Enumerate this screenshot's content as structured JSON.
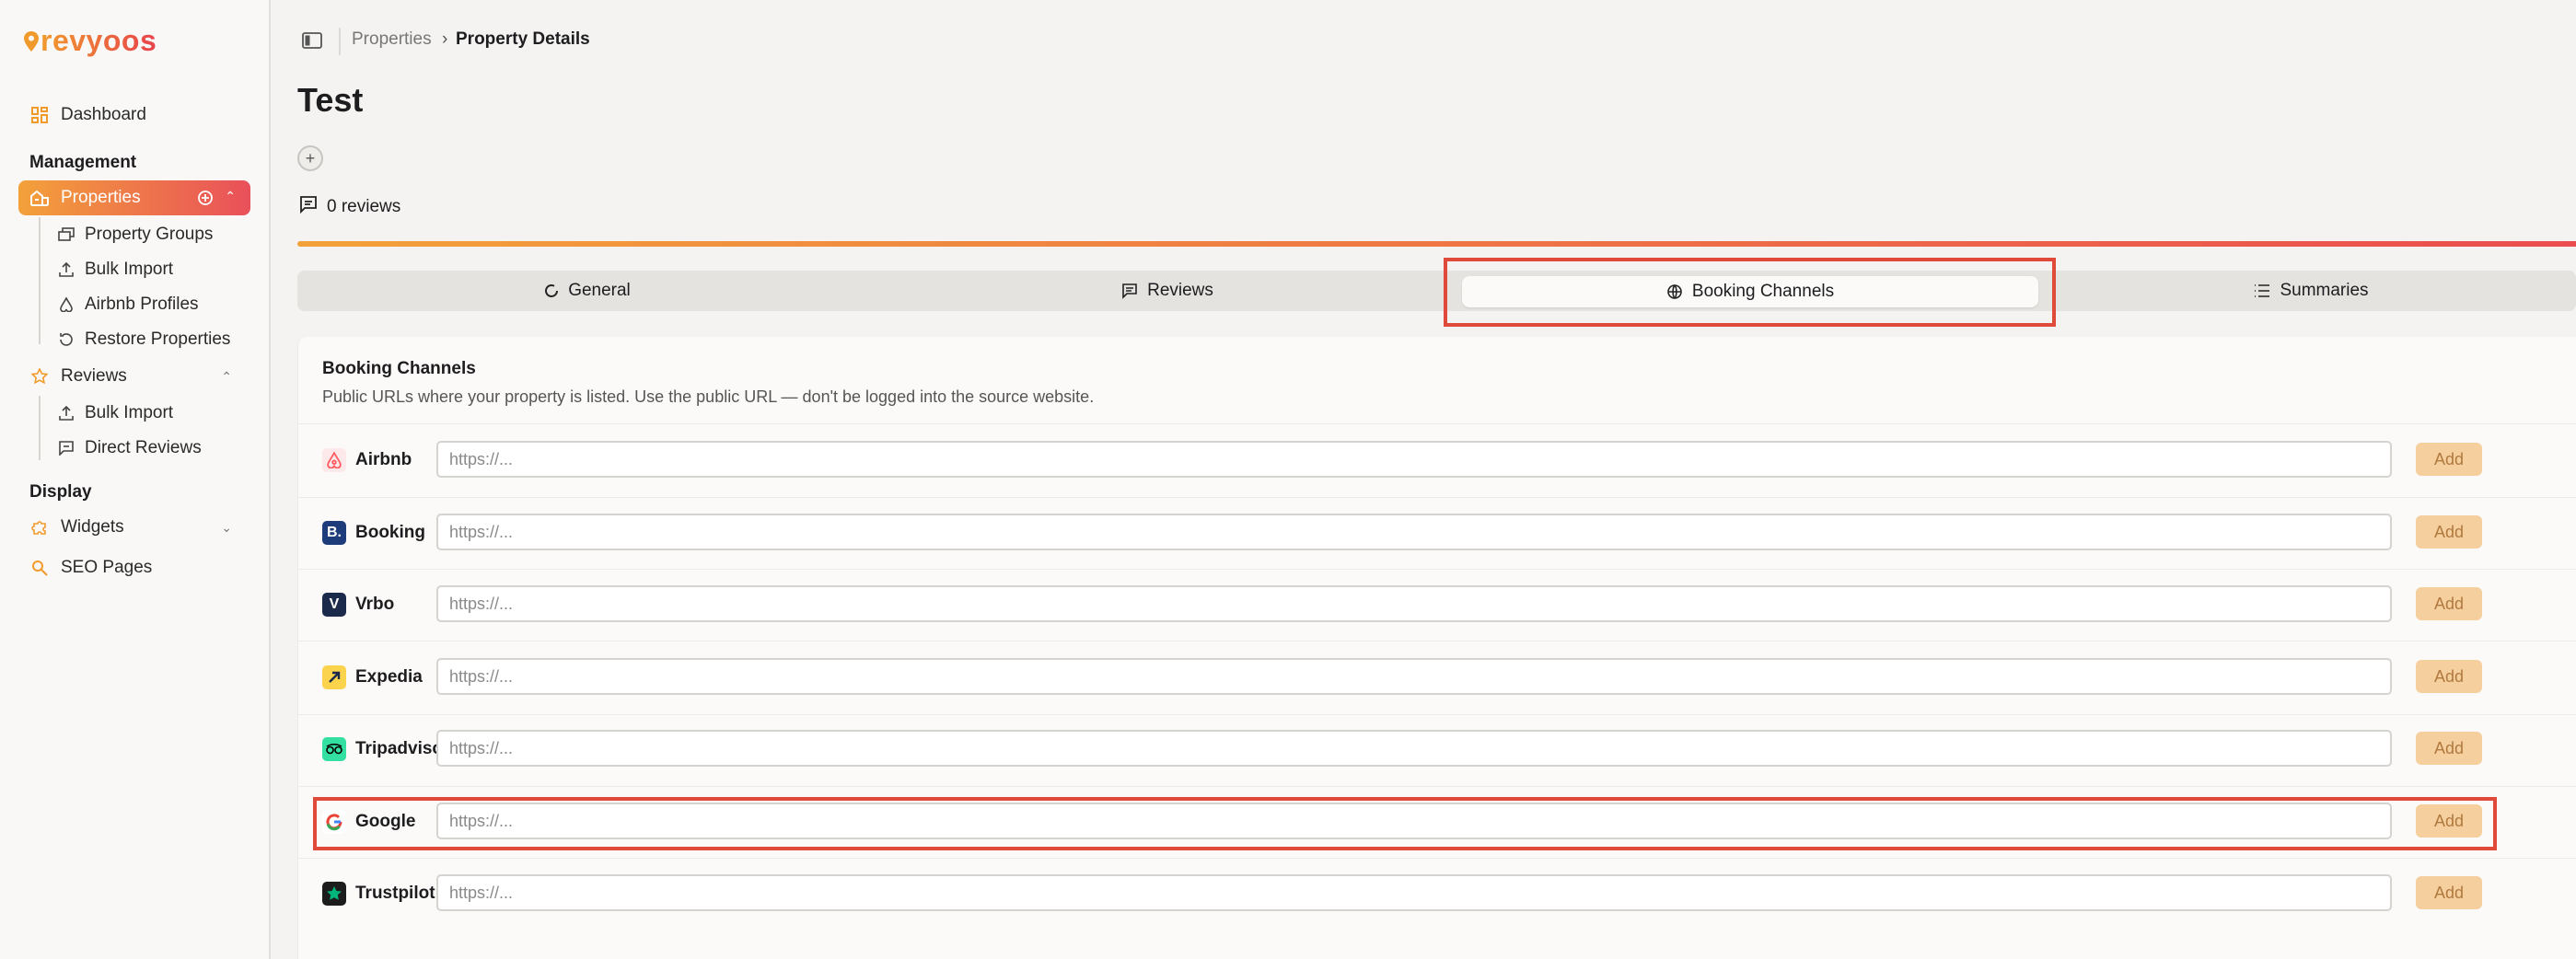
{
  "app": {
    "name": "revyoos"
  },
  "sidebar": {
    "dashboard": "Dashboard",
    "management_label": "Management",
    "properties": "Properties",
    "properties_children": [
      "Property Groups",
      "Bulk Import",
      "Airbnb Profiles",
      "Restore Properties"
    ],
    "reviews": "Reviews",
    "reviews_children": [
      "Bulk Import",
      "Direct Reviews"
    ],
    "display_label": "Display",
    "widgets": "Widgets",
    "seo_pages": "SEO Pages"
  },
  "breadcrumb": {
    "parent": "Properties",
    "separator": "›",
    "current": "Property Details"
  },
  "page": {
    "title": "Test",
    "reviews_count": "0 reviews"
  },
  "tabs": [
    {
      "label": "General",
      "icon": "spinner-icon"
    },
    {
      "label": "Reviews",
      "icon": "message-icon"
    },
    {
      "label": "Booking Channels",
      "icon": "globe-icon",
      "active": true
    },
    {
      "label": "Summaries",
      "icon": "list-icon"
    }
  ],
  "card": {
    "title": "Booking Channels",
    "subtitle": "Public URLs where your property is listed. Use the public URL — don't be logged into the source website."
  },
  "channels": [
    {
      "name": "Airbnb",
      "placeholder": "https://...",
      "button": "Add",
      "color": "#ff5a5f"
    },
    {
      "name": "Booking",
      "placeholder": "https://...",
      "button": "Add",
      "color": "#1e3c7a"
    },
    {
      "name": "Vrbo",
      "placeholder": "https://...",
      "button": "Add",
      "color": "#1b2a4a"
    },
    {
      "name": "Expedia",
      "placeholder": "https://...",
      "button": "Add",
      "color": "#fcd34d"
    },
    {
      "name": "Tripadvisor",
      "placeholder": "https://...",
      "button": "Add",
      "color": "#34e0a1"
    },
    {
      "name": "Google",
      "placeholder": "https://...",
      "button": "Add",
      "color": "#4285f4"
    },
    {
      "name": "Trustpilot",
      "placeholder": "https://...",
      "button": "Add",
      "color": "#1c1c1c"
    }
  ],
  "colors": {
    "accent_start": "#f3a13a",
    "accent_end": "#e9505a",
    "highlight": "#e04a3a",
    "add_button": "#f6cf9f"
  }
}
